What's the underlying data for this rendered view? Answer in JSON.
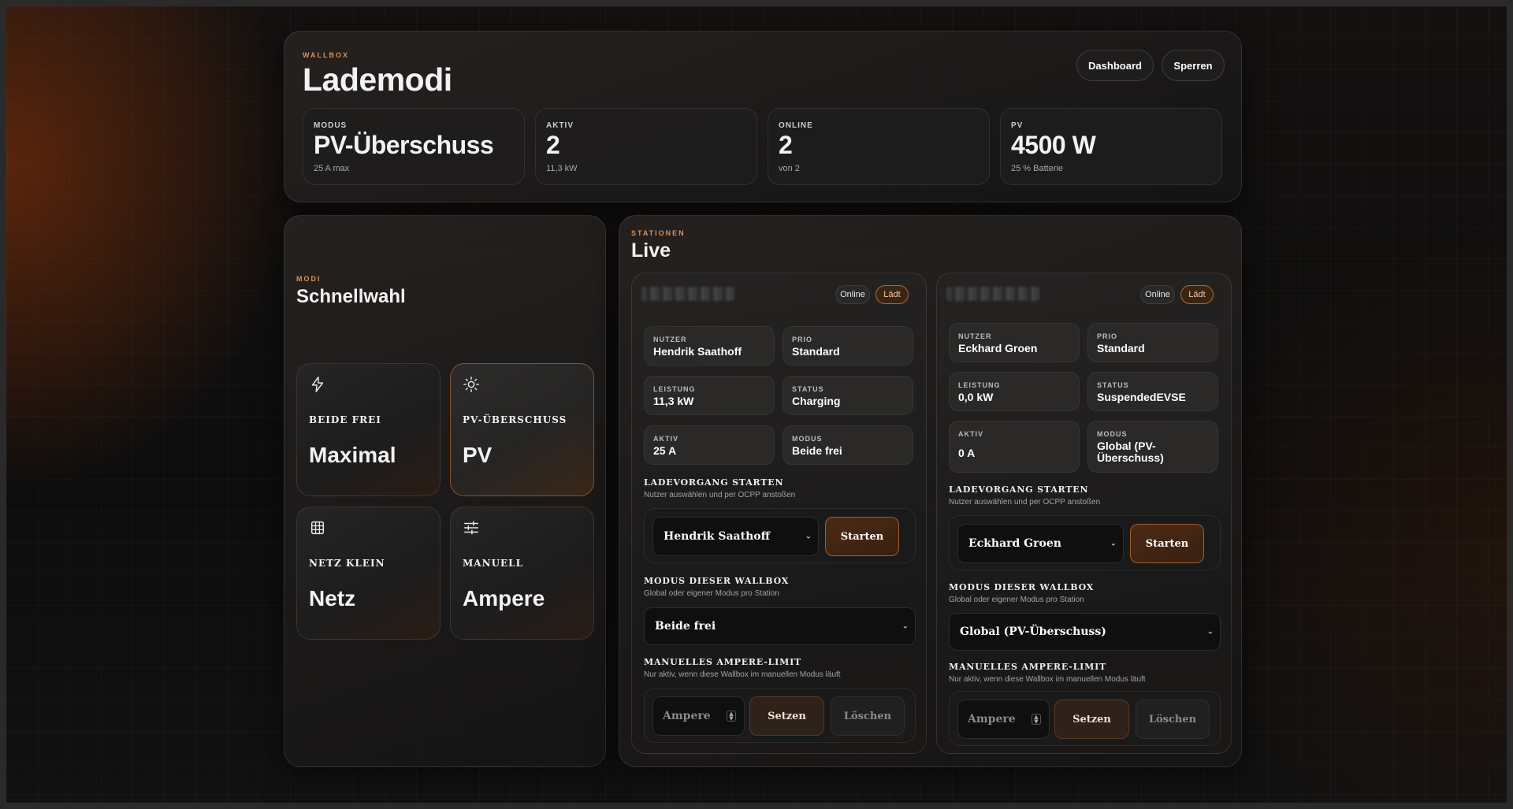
{
  "header": {
    "eyebrow": "WALLBOX",
    "title": "Lademodi",
    "buttons": {
      "dashboard": "Dashboard",
      "lock": "Sperren"
    },
    "stats": [
      {
        "label": "MODUS",
        "value": "PV-Überschuss",
        "sub": "25 A max"
      },
      {
        "label": "AKTIV",
        "value": "2",
        "sub": "11,3 kW"
      },
      {
        "label": "ONLINE",
        "value": "2",
        "sub": "von 2"
      },
      {
        "label": "PV",
        "value": "4500 W",
        "sub": "25 % Batterie"
      }
    ]
  },
  "modes": {
    "eyebrow": "MODI",
    "title": "Schnellwahl",
    "tiles": [
      {
        "label": "BEIDE FREI",
        "value": "Maximal",
        "icon": "bolt-icon",
        "active": false
      },
      {
        "label": "PV-ÜBERSCHUSS",
        "value": "PV",
        "icon": "sun-icon",
        "active": true
      },
      {
        "label": "NETZ KLEIN",
        "value": "Netz",
        "icon": "grid-icon",
        "active": false
      },
      {
        "label": "MANUELL",
        "value": "Ampere",
        "icon": "sliders-icon",
        "active": false
      }
    ]
  },
  "live": {
    "eyebrow": "STATIONEN",
    "title": "Live",
    "stations": [
      {
        "status_online": "Online",
        "status_charging": "Lädt",
        "user_label": "NUTZER",
        "user": "Hendrik Saathoff",
        "prio_label": "PRIO",
        "prio": "Standard",
        "power_label": "LEISTUNG",
        "power": "11,3 kW",
        "status_label": "STATUS",
        "status": "Charging",
        "active_label": "AKTIV",
        "active": "25 A",
        "mode_label": "MODUS",
        "mode": "Beide frei",
        "start_title": "LADEVORGANG STARTEN",
        "start_sub": "Nutzer auswählen und per OCPP anstoßen",
        "start_select": "Hendrik Saathoff",
        "start_button": "Starten",
        "mode_title": "MODUS DIESER WALLBOX",
        "mode_sub": "Global oder eigener Modus pro Station",
        "mode_select": "Beide frei",
        "amp_title": "MANUELLES AMPERE-LIMIT",
        "amp_sub": "Nur aktiv, wenn diese Wallbox im manuellen Modus läuft",
        "amp_placeholder": "Ampere",
        "set_button": "Setzen",
        "clear_button": "Löschen"
      },
      {
        "status_online": "Online",
        "status_charging": "Lädt",
        "user_label": "NUTZER",
        "user": "Eckhard Groen",
        "prio_label": "PRIO",
        "prio": "Standard",
        "power_label": "LEISTUNG",
        "power": "0,0 kW",
        "status_label": "STATUS",
        "status": "SuspendedEVSE",
        "active_label": "AKTIV",
        "active": "0 A",
        "mode_label": "MODUS",
        "mode": "Global (PV-Überschuss)",
        "start_title": "LADEVORGANG STARTEN",
        "start_sub": "Nutzer auswählen und per OCPP anstoßen",
        "start_select": "Eckhard Groen",
        "start_button": "Starten",
        "mode_title": "MODUS DIESER WALLBOX",
        "mode_sub": "Global oder eigener Modus pro Station",
        "mode_select": "Global (PV-Überschuss)",
        "amp_title": "MANUELLES AMPERE-LIMIT",
        "amp_sub": "Nur aktiv, wenn diese Wallbox im manuellen Modus läuft",
        "amp_placeholder": "Ampere",
        "set_button": "Setzen",
        "clear_button": "Löschen"
      }
    ]
  },
  "colors": {
    "accent": "#d9925a",
    "charging": "#3a2515",
    "background": "#0d0d0d"
  }
}
